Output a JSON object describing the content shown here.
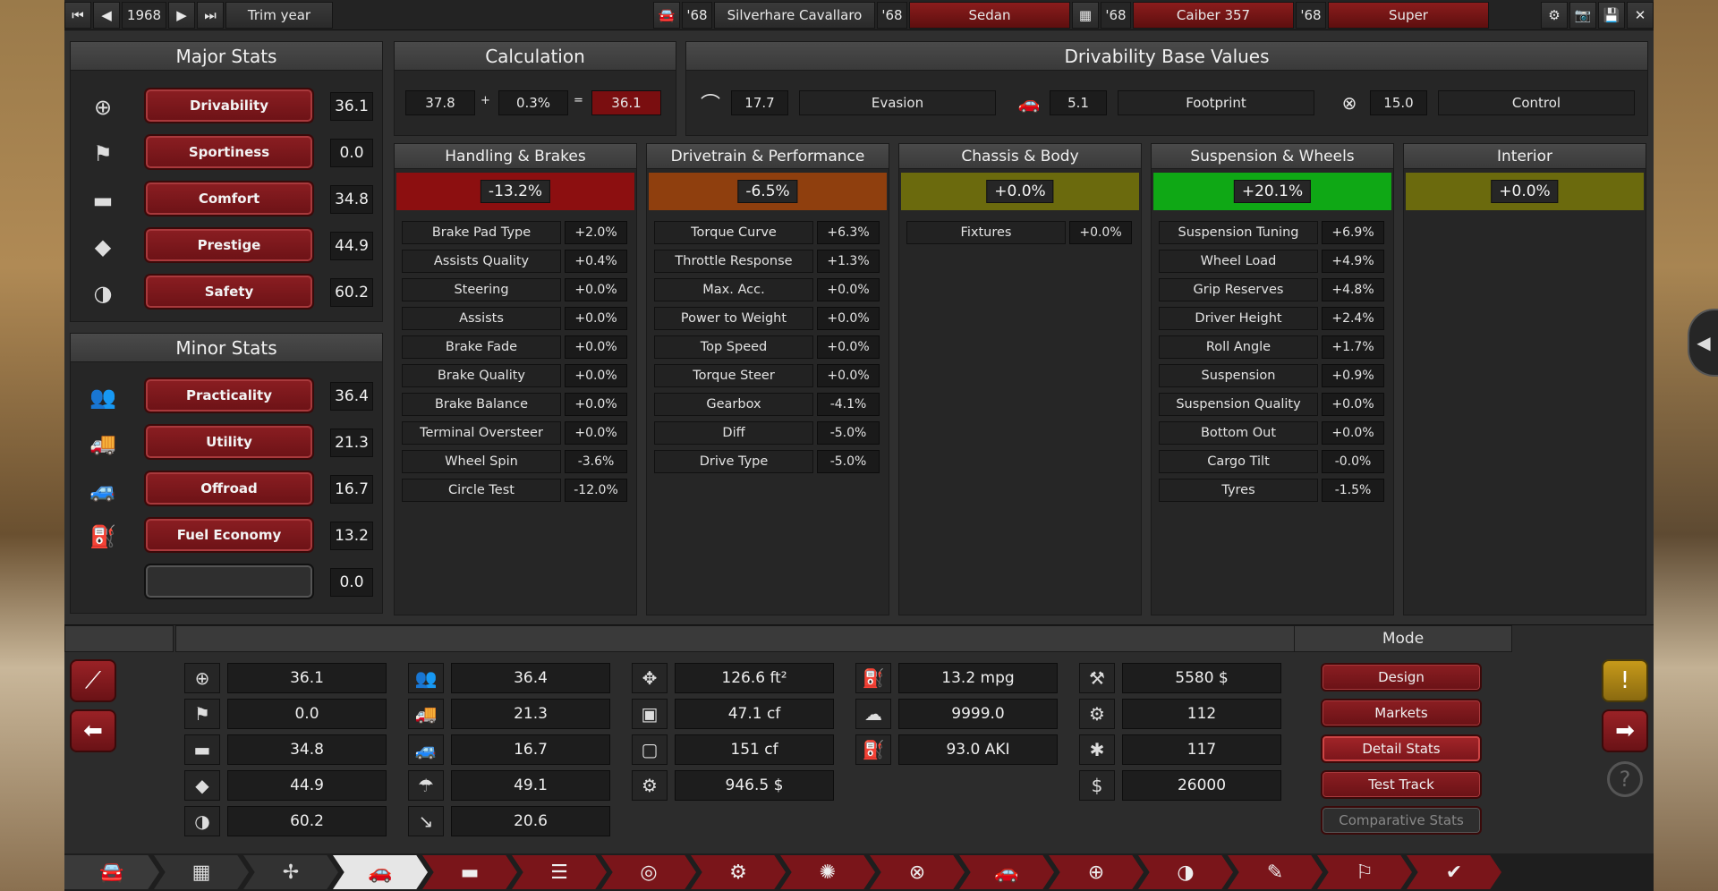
{
  "topbar": {
    "year": "1968",
    "trim_label": "Trim year",
    "model_year": "'68",
    "model_name": "Silverhare Cavallaro",
    "body_year": "'68",
    "body_name": "Sedan",
    "engine_year": "'68",
    "engine_name": "Caiber 357",
    "trim_year": "'68",
    "trim_name": "Super"
  },
  "major": {
    "title": "Major Stats",
    "items": [
      {
        "label": "Drivability",
        "value": "36.1",
        "icon": "steering-wheel-icon"
      },
      {
        "label": "Sportiness",
        "value": "0.0",
        "icon": "checkered-flag-icon"
      },
      {
        "label": "Comfort",
        "value": "34.8",
        "icon": "seat-icon"
      },
      {
        "label": "Prestige",
        "value": "44.9",
        "icon": "diamond-icon"
      },
      {
        "label": "Safety",
        "value": "60.2",
        "icon": "safety-icon"
      }
    ]
  },
  "minor": {
    "title": "Minor Stats",
    "items": [
      {
        "label": "Practicality",
        "value": "36.4",
        "icon": "passengers-icon"
      },
      {
        "label": "Utility",
        "value": "21.3",
        "icon": "utility-truck-icon"
      },
      {
        "label": "Offroad",
        "value": "16.7",
        "icon": "offroad-car-icon"
      },
      {
        "label": "Fuel Economy",
        "value": "13.2",
        "icon": "fuel-icon"
      },
      {
        "label": "",
        "value": "0.0",
        "icon": ""
      }
    ]
  },
  "calc": {
    "title": "Calculation",
    "base": "37.8",
    "plus": "+",
    "mod": "0.3%",
    "eq": "=",
    "result": "36.1"
  },
  "base_values": {
    "title": "Drivability Base Values",
    "evasion_value": "17.7",
    "evasion_label": "Evasion",
    "footprint_value": "5.1",
    "footprint_label": "Footprint",
    "control_value": "15.0",
    "control_label": "Control"
  },
  "categories": [
    {
      "title": "Handling & Brakes",
      "pct": "-13.2%",
      "color": "#8c0f10",
      "rows": [
        [
          "Brake Pad Type",
          "+2.0%"
        ],
        [
          "Assists Quality",
          "+0.4%"
        ],
        [
          "Steering",
          "+0.0%"
        ],
        [
          "Assists",
          "+0.0%"
        ],
        [
          "Brake Fade",
          "+0.0%"
        ],
        [
          "Brake Quality",
          "+0.0%"
        ],
        [
          "Brake Balance",
          "+0.0%"
        ],
        [
          "Terminal Oversteer",
          "+0.0%"
        ],
        [
          "Wheel Spin",
          "-3.6%"
        ],
        [
          "Circle Test",
          "-12.0%"
        ]
      ]
    },
    {
      "title": "Drivetrain & Performance",
      "pct": "-6.5%",
      "color": "#8f3f0e",
      "rows": [
        [
          "Torque Curve",
          "+6.3%"
        ],
        [
          "Throttle Response",
          "+1.3%"
        ],
        [
          "Max. Acc.",
          "+0.0%"
        ],
        [
          "Power to Weight",
          "+0.0%"
        ],
        [
          "Top Speed",
          "+0.0%"
        ],
        [
          "Torque Steer",
          "+0.0%"
        ],
        [
          "Gearbox",
          "-4.1%"
        ],
        [
          "Diff",
          "-5.0%"
        ],
        [
          "Drive Type",
          "-5.0%"
        ]
      ]
    },
    {
      "title": "Chassis & Body",
      "pct": "+0.0%",
      "color": "#6b6a0d",
      "rows": [
        [
          "Fixtures",
          "+0.0%"
        ]
      ]
    },
    {
      "title": "Suspension & Wheels",
      "pct": "+20.1%",
      "color": "#0fa815",
      "rows": [
        [
          "Suspension Tuning",
          "+6.9%"
        ],
        [
          "Wheel Load",
          "+4.9%"
        ],
        [
          "Grip Reserves",
          "+4.8%"
        ],
        [
          "Driver Height",
          "+2.4%"
        ],
        [
          "Roll Angle",
          "+1.7%"
        ],
        [
          "Suspension",
          "+0.9%"
        ],
        [
          "Suspension Quality",
          "+0.0%"
        ],
        [
          "Bottom Out",
          "+0.0%"
        ],
        [
          "Cargo Tilt",
          "-0.0%"
        ],
        [
          "Tyres",
          "-1.5%"
        ]
      ]
    },
    {
      "title": "Interior",
      "pct": "+0.0%",
      "color": "#6b6a0d",
      "rows": []
    }
  ],
  "summary": {
    "col1": [
      "36.1",
      "0.0",
      "34.8",
      "44.9",
      "60.2"
    ],
    "col2": [
      "36.4",
      "21.3",
      "16.7",
      "49.1",
      "20.6"
    ],
    "col3": [
      "126.6 ft²",
      "47.1 cf",
      "151 cf",
      "946.5 $"
    ],
    "col4": [
      "13.2 mpg",
      "9999.0",
      "93.0 AKI"
    ],
    "col5": [
      "5580 $",
      "112",
      "117",
      "26000"
    ]
  },
  "mode": {
    "title": "Mode",
    "buttons": [
      "Design",
      "Markets",
      "Detail Stats",
      "Test Track",
      "Comparative Stats"
    ]
  },
  "colors": {
    "accent_red": "#8b1e22",
    "good": "#0fa815",
    "bad": "#8c0f10"
  }
}
